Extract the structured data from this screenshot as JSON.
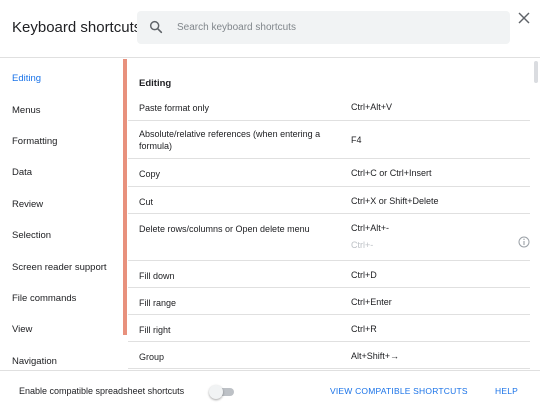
{
  "header": {
    "title": "Keyboard shortcuts",
    "search_placeholder": "Search keyboard shortcuts",
    "search_value": ""
  },
  "sidebar": {
    "items": [
      {
        "label": "Editing",
        "active": true
      },
      {
        "label": "Menus",
        "active": false
      },
      {
        "label": "Formatting",
        "active": false
      },
      {
        "label": "Data",
        "active": false
      },
      {
        "label": "Review",
        "active": false
      },
      {
        "label": "Selection",
        "active": false
      },
      {
        "label": "Screen reader support",
        "active": false
      },
      {
        "label": "File commands",
        "active": false
      },
      {
        "label": "View",
        "active": false
      },
      {
        "label": "Navigation",
        "active": false
      }
    ]
  },
  "main": {
    "section_title": "Editing",
    "rows": [
      {
        "name": "Paste format only",
        "key": "Ctrl+Alt+V"
      },
      {
        "name": "Absolute/relative references (when entering a formula)",
        "key": "F4"
      },
      {
        "name": "Copy",
        "key": "Ctrl+C or Ctrl+Insert"
      },
      {
        "name": "Cut",
        "key": "Ctrl+X or Shift+Delete"
      },
      {
        "name": "Delete rows/columns or Open delete menu",
        "key": "Ctrl+Alt+-",
        "key_alt": "Ctrl+-"
      },
      {
        "name": "Fill down",
        "key": "Ctrl+D"
      },
      {
        "name": "Fill range",
        "key": "Ctrl+Enter"
      },
      {
        "name": "Fill right",
        "key": "Ctrl+R"
      },
      {
        "name": "Group",
        "key": "Alt+Shift+→"
      }
    ]
  },
  "footer": {
    "toggle_label": "Enable compatible spreadsheet shortcuts",
    "toggle_on": false,
    "view_link": "VIEW COMPATIBLE SHORTCUTS",
    "help_link": "HELP"
  },
  "colors": {
    "accent": "#1a73e8",
    "sidebar_indicator": "#e8917d"
  },
  "icons": {
    "search": "search-icon",
    "close": "close-icon",
    "info": "info-icon"
  }
}
